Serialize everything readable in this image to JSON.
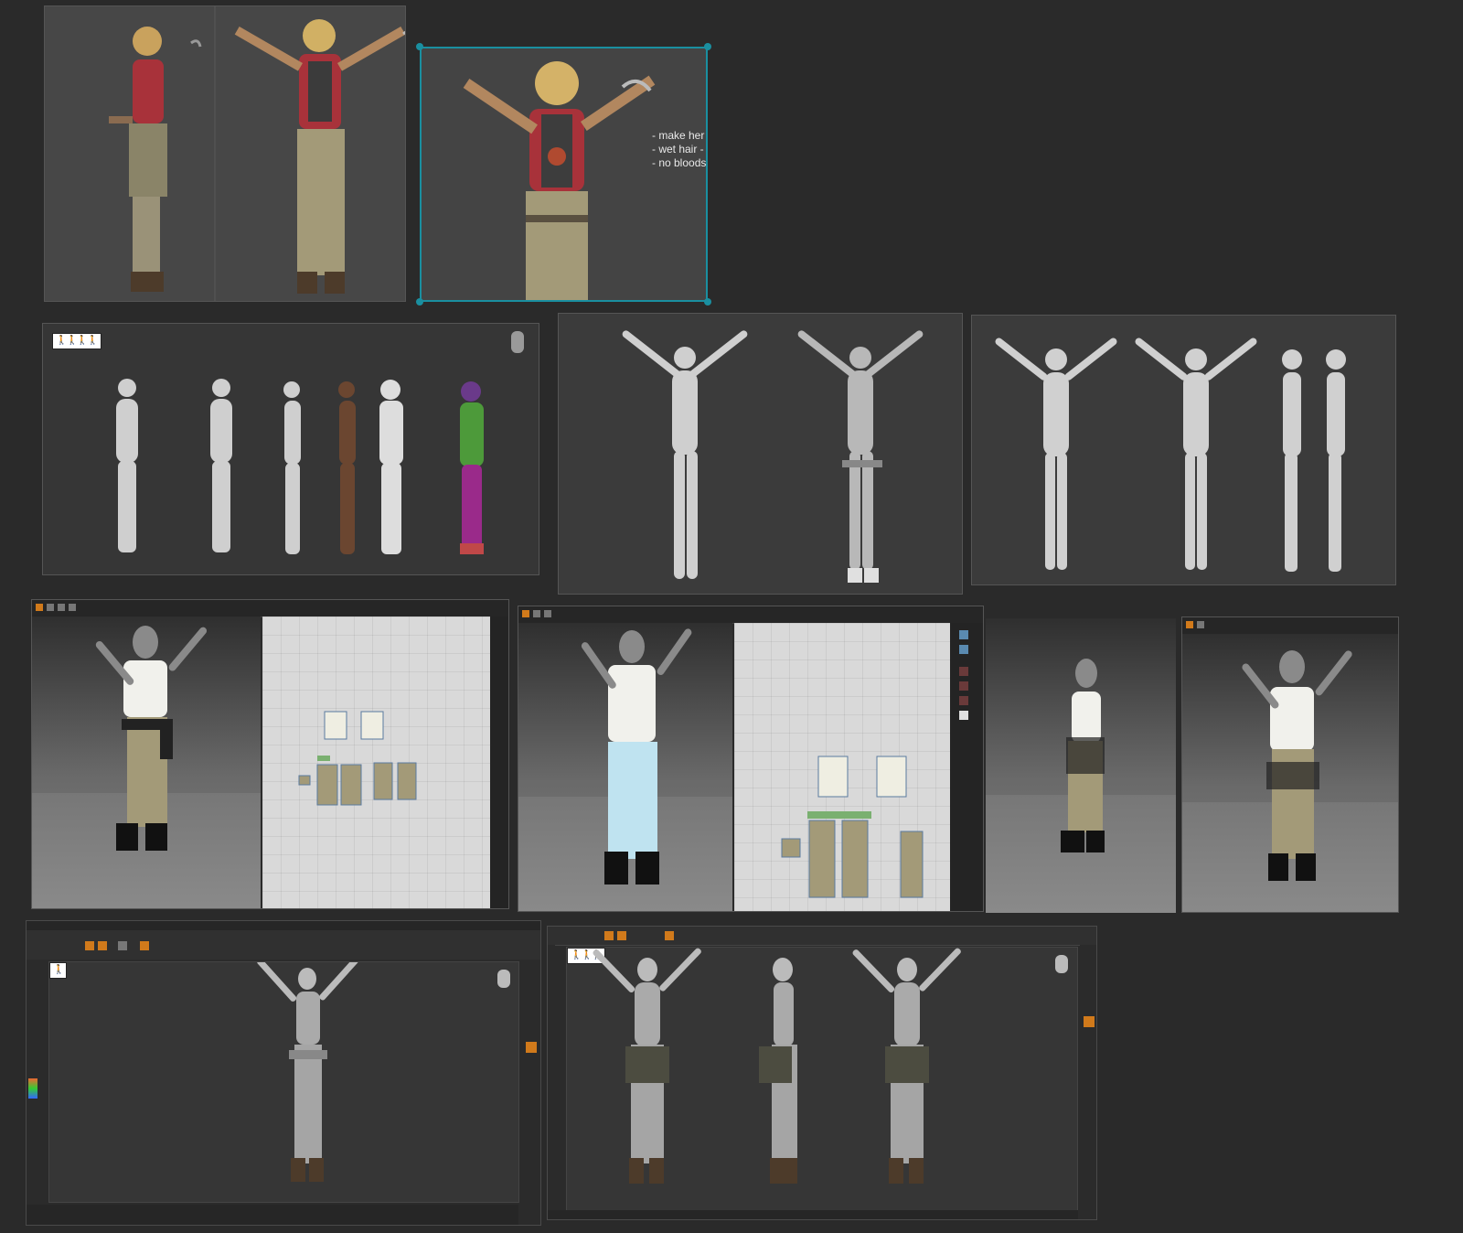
{
  "notes": {
    "line1": "- make her",
    "line2": "- wet hair -",
    "line3": "- no bloods"
  },
  "badges": {
    "turnaround_icon": "🚶🚶🚶🚶",
    "single_icon": "🚶",
    "trio_icon": "🚶🚶🚶"
  },
  "colors": {
    "background": "#2a2a2a",
    "selection": "#1a8fa0",
    "accent_orange": "#d17a1b",
    "vest_red": "#a8323a",
    "pants_khaki": "#a39a78",
    "pants_lightblue": "#bfe3f0",
    "shirt_white": "#f1f1ec",
    "clay_grey": "#c9c9c9"
  },
  "icons": [
    "selection-handle-icon",
    "figure-icon",
    "knife-icon",
    "head-navigator-icon",
    "color-picker-icon"
  ]
}
